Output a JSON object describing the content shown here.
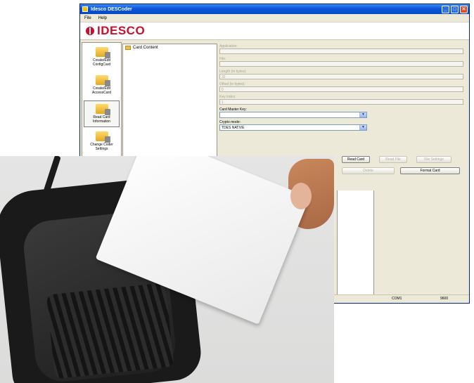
{
  "window": {
    "title": "Idesco DESCoder",
    "controls": {
      "minimize": "_",
      "maximize": "□",
      "close": "✕"
    }
  },
  "menu": [
    "File",
    "Help"
  ],
  "logo": {
    "text": "IDESCO",
    "color": "#c8102e"
  },
  "sidebar": {
    "items": [
      {
        "label": "Create/Edit ConfigCard",
        "icon": "card-edit-icon"
      },
      {
        "label": "Create/Edit AccessCard",
        "icon": "card-edit-icon"
      },
      {
        "label": "Read Card Information",
        "icon": "card-read-icon",
        "active": true
      },
      {
        "label": "Change Coder Settings",
        "icon": "settings-icon"
      }
    ]
  },
  "tree": {
    "root_label": "Card Content"
  },
  "fields": {
    "application_label": "Application:",
    "file_label": "File:",
    "length_label": "Length (in bytes):",
    "length_value": "32",
    "offset_label": "Offset (in bytes):",
    "offset_value": "0",
    "keyindex_label": "Key index:",
    "keyindex_value": "1",
    "master_key_label": "Card Master Key:",
    "master_key_value": "",
    "crypto_label": "Crypto mode:",
    "crypto_value": "TDES NATIVE"
  },
  "buttons": {
    "read_card": "Read Card",
    "read_file": "Read File",
    "file_settings": "File Settings",
    "delete": "Delete",
    "format_card": "Format Card"
  },
  "status": {
    "port": "COM1",
    "baud": "9600"
  }
}
